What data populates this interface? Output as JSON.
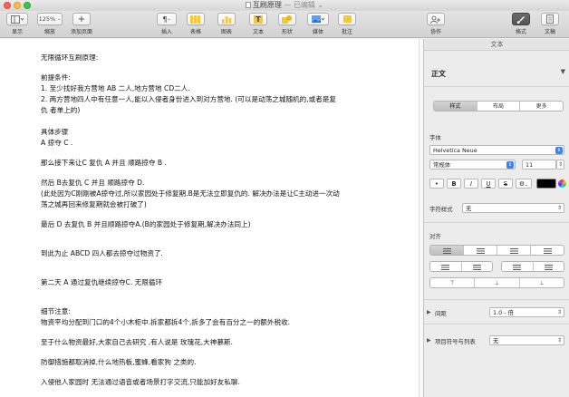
{
  "window": {
    "title": "互刷原理",
    "status": "— 已编辑",
    "title_arrow": "⌄"
  },
  "toolbar": {
    "view_label": "显示",
    "zoom_value": "125%",
    "zoom_label": "缩放",
    "add_page_label": "添加页面",
    "add_page_icon": "+",
    "insert_icon": "¶",
    "insert_label": "插入",
    "table_label": "表格",
    "chart_label": "图表",
    "text_icon": "T",
    "text_label": "文本",
    "shape_label": "形状",
    "media_label": "媒体",
    "comment_label": "批注",
    "collab_label": "协作",
    "format_label": "格式",
    "document_label": "文稿"
  },
  "document": {
    "lines": [
      "无限循环互刷原理:",
      "前提条件:",
      "1.   至少找好我方营地 AB 二人,地方营地 CD二人.",
      "2.   两方营地四人中有任意一人,能以入侵者身份进入到对方营地. (可以是动荡之城随机的,或者是复",
      "     仇 者单上的)",
      "具体步骤",
      " A 掠夺 C .",
      "  那么接下来让C 复仇 A 并且 顺路掠夺 B .",
      "  然后 B去复仇 C 并且 顺路掠夺 D.",
      "(此处因为C刚刚被A掠夺过,所以家园处于修复期.B是无法立即复仇的. 解决办法是让C主动进一次动",
      "荡之城再回来修复期就会被打破了)",
      "最后 D 去复仇 B 并且顺路掠夺A.(B的家园处于修复期,解决办法同上)",
      "到此为止   ABCD 四人都去掠夺过物资了.",
      "第二天  A 通过复仇继续掠夺C.   无限循环",
      "细节注意:",
      " 物资平均分配到门口的4个小木柜中.拆家都拆4个,拆多了会有百分之一的额外税收.",
      "  至于什么物资最好,大家自己去研究 ,有人说是 玫瑰花,大神慕斯.",
      "防御措施都取消掉,什么地热板,蜜蜂,看家狗 之类的.",
      "入侵他人家园时 无法通过语音或者场景打字交流,只能加好友私聊."
    ]
  },
  "inspector": {
    "header": "文本",
    "paragraph_style": "正文",
    "tabs": [
      "样式",
      "布局",
      "更多"
    ],
    "font_section": "字体",
    "font_name": "Helvetica Neue",
    "font_weight": "常规体",
    "font_size": "11",
    "format_buttons": [
      "•",
      "B",
      "I",
      "U",
      "S"
    ],
    "gear_icon": "⚙",
    "char_style_label": "字符样式",
    "char_style_value": "无",
    "alignment_section": "对齐",
    "spacing_label": "间距",
    "spacing_value": "1.0 - 倍",
    "bullets_label": "项目符号与列表",
    "bullets_value": "无"
  },
  "colors": {
    "accent": "#3c84f5",
    "toolbar_yellow": "#f8c731",
    "text_color_well": "#000000"
  }
}
